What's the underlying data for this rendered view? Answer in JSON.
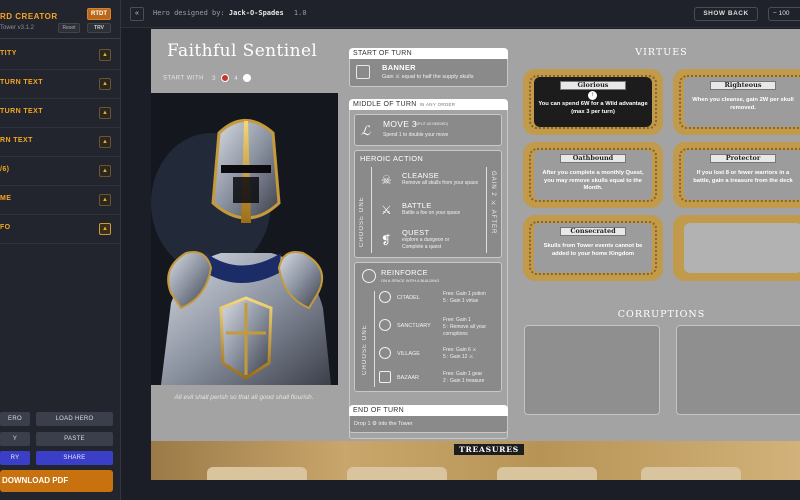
{
  "sidebar": {
    "title": "RD CREATOR",
    "subtitle": "Tower v3.1.2",
    "rtdt_label": "RTDT",
    "reset_label": "Reset",
    "trv_label": "TRV",
    "sections": [
      {
        "label": "TITY"
      },
      {
        "label": "TURN TEXT"
      },
      {
        "label": "TURN TEXT"
      },
      {
        "label": "RN TEXT"
      },
      {
        "label": "/6)"
      },
      {
        "label": "ME"
      },
      {
        "label": "FO"
      }
    ],
    "buttons": {
      "save_hero": "ERO",
      "load_hero": "LOAD HERO",
      "copy": "Y",
      "paste": "PASTE",
      "gallery": "RY",
      "share": "SHARE"
    },
    "download_label": "DOWNLOAD PDF"
  },
  "topbar": {
    "collapse_icon": "«",
    "designed_by_prefix": "Hero designed by:",
    "designer_name": "Jack-O-Spades",
    "version": "1.0",
    "show_back_label": "SHOW BACK",
    "zoom_label": "−   100"
  },
  "card": {
    "hero_name": "Faithful Sentinel",
    "start_with_label": "START WITH",
    "start_with_values": [
      "3",
      "4"
    ],
    "quote": "All evil shall perish so that all good shall flourish.",
    "start_of_turn": {
      "heading": "START OF TURN",
      "banner_title": "BANNER",
      "banner_text": "Gain ⚔ equal to half the supply skulls"
    },
    "middle_of_turn": {
      "heading": "MIDDLE OF TURN",
      "heading_note": "IN ANY ORDER",
      "move_title": "MOVE 3",
      "move_note": "(SPLIT AS NEEDED)",
      "move_text": "Spend 1   to double your move",
      "heroic_action_title": "HEROIC ACTION",
      "choose_one": "CHOOSE ONE",
      "gain_after": "GAIN 2 ⚔ AFTER",
      "actions": [
        {
          "name": "CLEANSE",
          "text": "Remove all skulls from your space"
        },
        {
          "name": "BATTLE",
          "text": "Battle a foe on your space"
        },
        {
          "name": "QUEST",
          "text": "explore a dungeon or",
          "text2": "Complete a quest"
        }
      ],
      "reinforce_title": "REINFORCE",
      "reinforce_note": "ON A SPACE WITH A BUILDING",
      "choose_one_2": "CHOOSE ONE",
      "buildings": [
        {
          "name": "CITADEL",
          "free": "Free: Gain 1 potion",
          "pay": "5    : Gain 1 virtue"
        },
        {
          "name": "SANCTUARY",
          "free": "Free: Gain 1",
          "pay": "5    : Remove all your",
          "pay2": "corruptions"
        },
        {
          "name": "VILLAGE",
          "free": "Free: Gain 6   ⚔",
          "pay": "5    : Gain 12  ⚔"
        },
        {
          "name": "BAZAAR",
          "free": "Free: Gain 1 gear",
          "pay": "2    : Gain 1 treasure"
        }
      ]
    },
    "end_of_turn": {
      "heading": "END OF TURN",
      "text": "Drop 1 ⚙ into the Tower"
    },
    "virtues_title": "VIRTUES",
    "virtues": [
      {
        "name": "Glorious",
        "text": "You can spend 6W for a Wild advantage (max 3 per turn)",
        "active": true
      },
      {
        "name": "Righteous",
        "text": "When you cleanse, gain 2W per skull removed.",
        "active": false
      },
      {
        "name": "Oathbound",
        "text": "After you complete a monthly Quest, you may remove skulls equal to the Month.",
        "active": false
      },
      {
        "name": "Protector",
        "text": "If you lost 8 or fewer warriors in a battle, gain a treasure from the deck",
        "active": false
      },
      {
        "name": "Consecrated",
        "text": "Skulls from Tower events cannot be added to your home Kingdom",
        "active": false
      }
    ],
    "corruptions_title": "CORRUPTIONS",
    "treasures_title": "TREASURES"
  }
}
